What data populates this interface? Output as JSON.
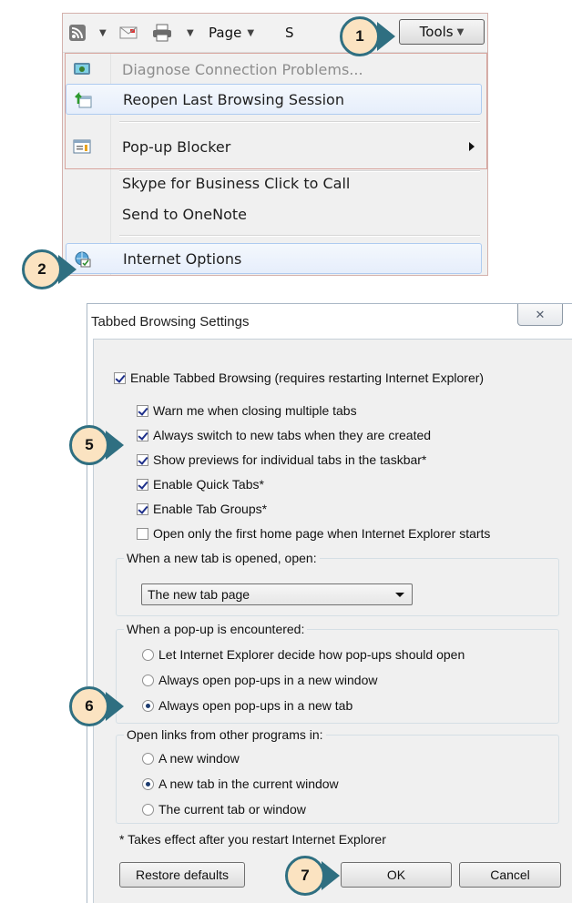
{
  "toolbar": {
    "page_label": "Page",
    "safety_label": "S",
    "tools_label": "Tools"
  },
  "tools_menu": {
    "items": [
      {
        "label": "Diagnose Connection Problems...",
        "icon": "network-diagnose-icon",
        "disabled": true
      },
      {
        "label": "Reopen Last Browsing Session",
        "icon": "reopen-session-icon"
      },
      {
        "label": "Pop-up Blocker",
        "icon": "popup-blocker-icon",
        "submenu": true
      },
      {
        "label": "Skype for Business Click to Call"
      },
      {
        "label": "Send to OneNote"
      },
      {
        "label": "Internet Options",
        "icon": "internet-options-icon"
      }
    ]
  },
  "callouts": {
    "one": "1",
    "two": "2",
    "five": "5",
    "six": "6",
    "seven": "7"
  },
  "dialog": {
    "title": "Tabbed Browsing Settings",
    "close_glyph": "✕",
    "enable_tabbed": {
      "label": "Enable Tabbed Browsing (requires restarting Internet Explorer)",
      "checked": true
    },
    "options": [
      {
        "label": "Warn me when closing multiple tabs",
        "checked": true
      },
      {
        "label": "Always switch to new tabs when they are created",
        "checked": true
      },
      {
        "label": "Show previews for individual tabs in the taskbar*",
        "checked": true
      },
      {
        "label": "Enable Quick Tabs*",
        "checked": true
      },
      {
        "label": "Enable Tab Groups*",
        "checked": true
      },
      {
        "label": "Open only the first home page when Internet Explorer starts",
        "checked": false
      }
    ],
    "new_tab_group": {
      "legend": "When a new tab is opened, open:",
      "selected": "The new tab page"
    },
    "popup_group": {
      "legend": "When a pop-up is encountered:",
      "options": [
        {
          "label": "Let Internet Explorer decide how pop-ups should open",
          "checked": false
        },
        {
          "label": "Always open pop-ups in a new window",
          "checked": false
        },
        {
          "label": "Always open pop-ups in a new tab",
          "checked": true
        }
      ]
    },
    "links_group": {
      "legend": "Open links from other programs in:",
      "options": [
        {
          "label": "A new window",
          "checked": false
        },
        {
          "label": "A new tab in the current window",
          "checked": true
        },
        {
          "label": "The current tab or window",
          "checked": false
        }
      ]
    },
    "footnote": "* Takes effect after you restart Internet Explorer",
    "buttons": {
      "restore": "Restore defaults",
      "ok": "OK",
      "cancel": "Cancel"
    }
  },
  "colors": {
    "callout_fill": "#fbe3c1",
    "callout_border": "#2f6f81",
    "highlight_border": "#aecbf0",
    "annotation_box": "#d8a59e"
  }
}
